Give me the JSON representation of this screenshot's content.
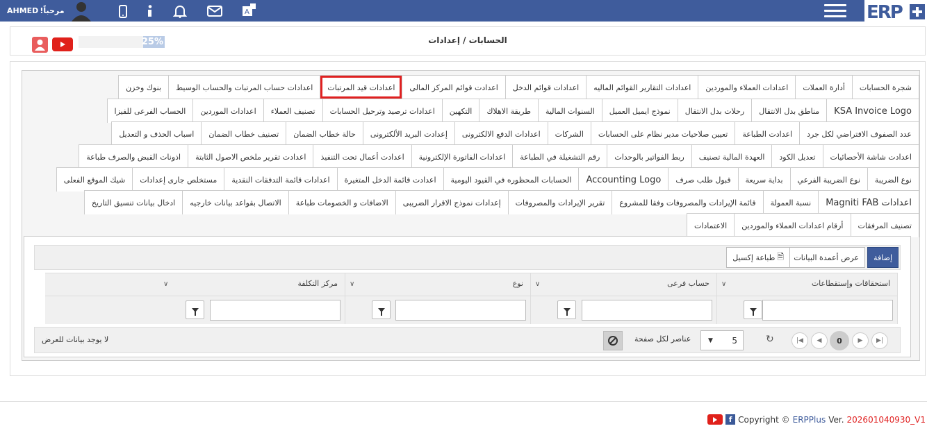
{
  "topbar": {
    "user_name": "AHMED",
    "greeting": "!مرحباً"
  },
  "page": {
    "title": "الحسابات / إعدادات",
    "progress_label": "25%",
    "progress": 0.25
  },
  "tabs": {
    "row1": [
      "شجرة الحسابات",
      "أدارة العملات",
      "اعدادات العملاء والموردين",
      "اعدادات التقارير القوائم الماليه",
      "اعدادات قوائم الدخل",
      "اعدادت قوائم المركز المالى",
      "اعدادات قيد المرتبات",
      "اعدادات حساب المرتبات والحساب الوسيط",
      "بنوك وخزن"
    ],
    "row2": [
      "KSA Invoice Logo",
      "مناطق بدل الانتقال",
      "رحلات بدل الانتقال",
      "نموذج ايميل العميل",
      "السنوات المالية",
      "طريقة الاهلاك",
      "التكهين",
      "اعدادات ترصيد وترحيل الحسابات",
      "تصنيف العملاء",
      "اعدادات الموردين",
      "الحساب الفرعى للفيزا"
    ],
    "row3": [
      "عدد الصفوف الافتراضي لكل جرد",
      "اعدادت الطباعة",
      "تعيين صلاحيات مدير نظام على الحسابات",
      "الشركات",
      "اعدادات الدفع الالكترونى",
      "إعدادت البريد الألكترونى",
      "حالة خطاب الضمان",
      "تصنيف خطاب الضمان",
      "اسباب الحذف و التعديل"
    ],
    "row4": [
      "اعدادت شاشة الأحصائيات",
      "تعديل الكود",
      "العهدة المالية تصنيف",
      "ربط الفواتير بالوحدات",
      "رقم التشغيلة في الطباعة",
      "اعدادات الفاتورة الإلكترونية",
      "اعدادت أعمال تحت التنفيذ",
      "اعدادت تقرير ملخص الاصول الثابتة",
      "اذونات القبض والصرف طباعة"
    ],
    "row5": [
      "نوع الضريبة",
      "نوع الضريبة الفرعي",
      "بداية سريعة",
      "قبول طلب صرف",
      "Accounting Logo",
      "الحسابات المحظوره في القيود اليومية",
      "اعدادت قائمة الدخل المتغيرة",
      "اعدادات قائمة التدفقات النقدية",
      "مستخلص جارى إعدادات",
      "شيك الموقع الفعلى"
    ],
    "row6": [
      "Magniti FAB اعدادات",
      "نسبة العمولة",
      "قائمة الإيرادات والمصروفات وفقا للمشروع",
      "تقرير الإيرادات والمصروفات",
      "إعدادات نموذج الاقرار الضريبى",
      "الاضافات و الخصومات طباعة",
      "الاتصال بقواعد بيانات خارجيه",
      "ادخال بيانات تنسيق التاريخ"
    ],
    "row7": [
      "تصنيف المرفقات",
      "أرقام اعدادات العملاء والموردين",
      "الاعتمادات"
    ]
  },
  "toolbar": {
    "add": "إضافة",
    "columns": "عرض أعمدة البيانات",
    "excel": "طباعة إكسيل"
  },
  "grid": {
    "columns": [
      "استحقاقات وإستقطاعات",
      "حساب فرعى",
      "نوع",
      "مركز التكلفة"
    ]
  },
  "footer": {
    "no_data": "لا يوجد بيانات للعرض",
    "per_page": "عناصر لكل صفحة",
    "page_size": "5",
    "current_page": "0"
  },
  "copyright": {
    "prefix": "Copyright ©",
    "brand": "ERPPlus",
    "ver_label": "Ver.",
    "version": "202601040930_V1"
  }
}
